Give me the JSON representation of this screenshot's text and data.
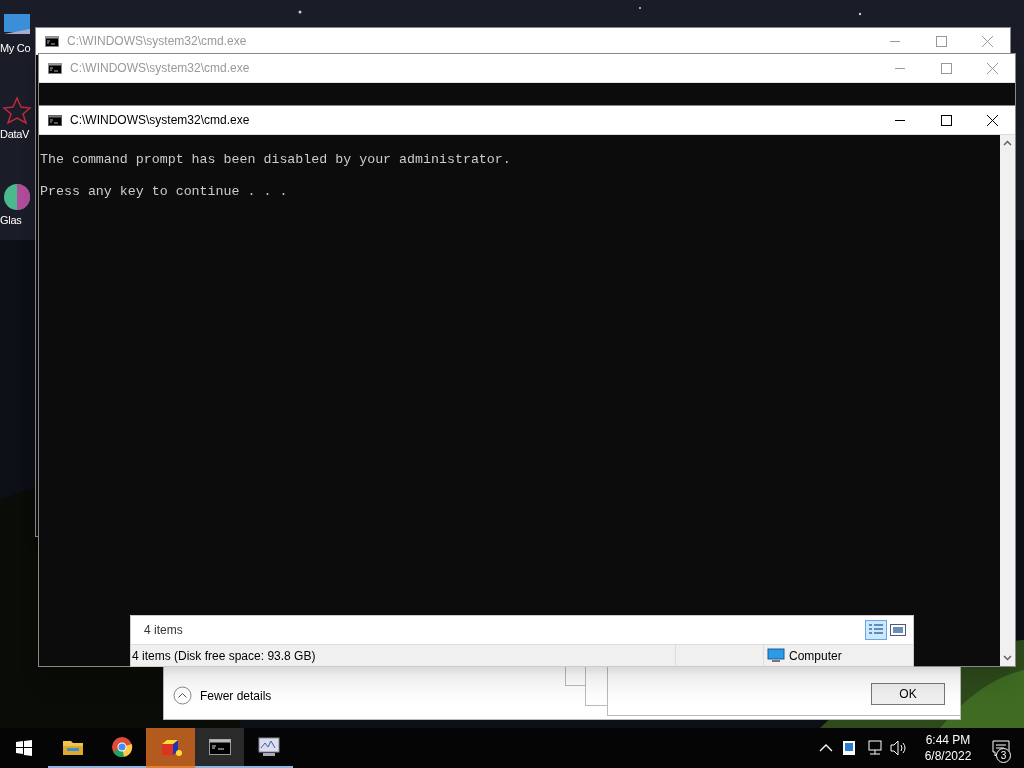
{
  "desktop_icons": [
    {
      "label": "My Co",
      "kind": "computer"
    },
    {
      "label": "DataV",
      "kind": "star"
    },
    {
      "label": "Glas",
      "kind": "ball"
    }
  ],
  "windows": [
    {
      "title": "C:\\WINDOWS\\system32\\cmd.exe",
      "active": false
    },
    {
      "title": "C:\\WINDOWS\\system32\\cmd.exe",
      "active": false
    },
    {
      "title": "C:\\WINDOWS\\system32\\cmd.exe",
      "active": true,
      "lines": [
        "The command prompt has been disabled by your administrator.",
        "Press any key to continue . . ."
      ]
    }
  ],
  "explorer_status": {
    "item_count": "4 items",
    "details": "4 items (Disk free space: 93.8 GB)",
    "location": "Computer",
    "views": [
      {
        "kind": "details",
        "selected": true
      },
      {
        "kind": "preview",
        "selected": false
      }
    ]
  },
  "dialog": {
    "toggle": "Fewer details",
    "button": "OK"
  },
  "taskbar": {
    "apps": [
      {
        "kind": "folder",
        "selected": false,
        "flashing": false
      },
      {
        "kind": "chrome",
        "selected": false,
        "flashing": false
      },
      {
        "kind": "cube",
        "selected": false,
        "flashing": true
      },
      {
        "kind": "console",
        "selected": true,
        "flashing": false
      },
      {
        "kind": "monitor",
        "selected": false,
        "flashing": false
      }
    ],
    "time": "6:44 PM",
    "date": "6/8/2022",
    "notifications": "3"
  }
}
